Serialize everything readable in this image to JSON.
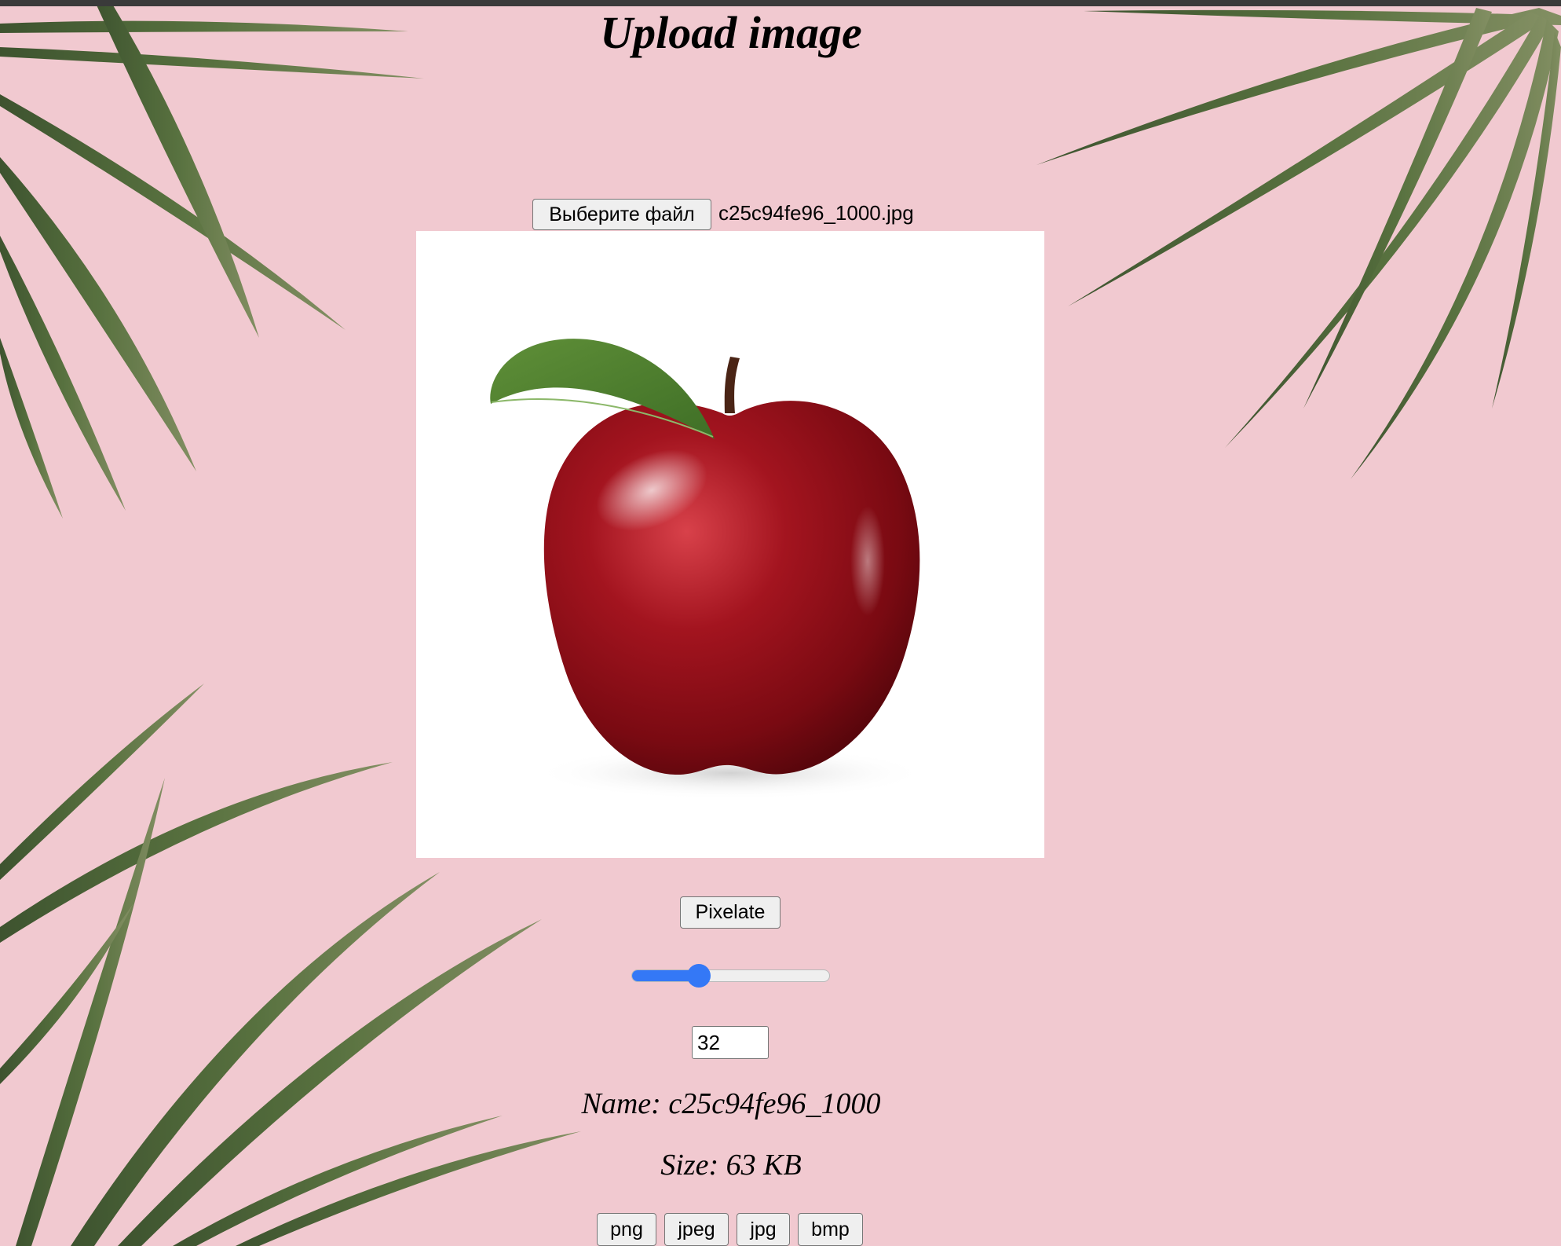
{
  "page": {
    "title": "Upload image"
  },
  "upload": {
    "button_label": "Выберите файл",
    "file_name": "c25c94fe96_1000.jpg"
  },
  "preview": {
    "subject": "red apple with green leaf on white background"
  },
  "controls": {
    "pixelate_label": "Pixelate",
    "slider_value_fraction": 0.34,
    "pixel_size_value": "32"
  },
  "info": {
    "name_text": "Name: c25c94fe96_1000",
    "size_text": "Size: 63 KB"
  },
  "formats": [
    "png",
    "jpeg",
    "jpg",
    "bmp"
  ],
  "colors": {
    "background": "#f1c9d0",
    "accent": "#3478f6",
    "palm_leaf": "#3f5a2c"
  },
  "icons": {
    "background_decoration": "palm-leaves"
  }
}
